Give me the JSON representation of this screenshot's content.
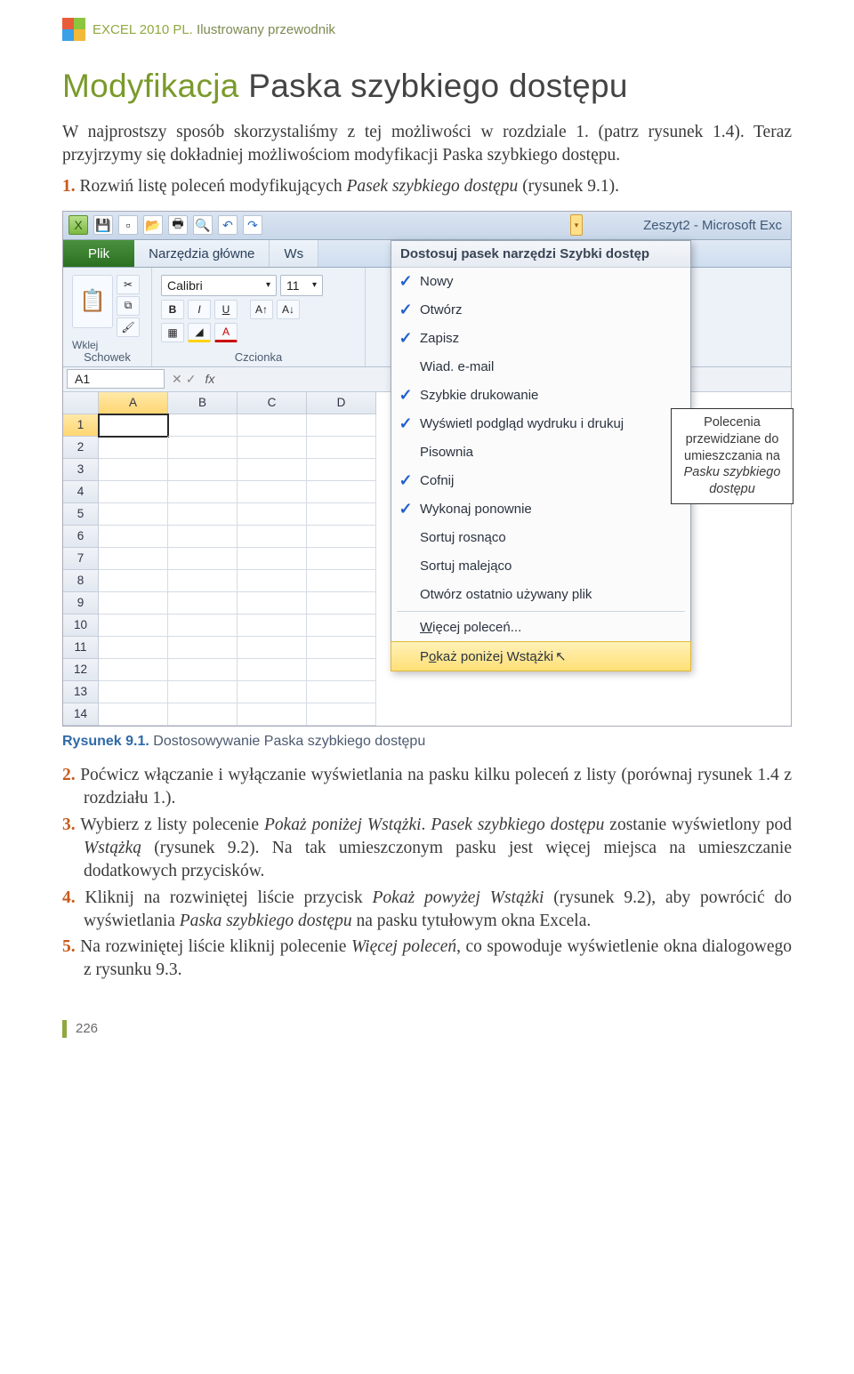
{
  "header": {
    "brand": "EXCEL 2010 PL.",
    "tagline": " Ilustrowany przewodnik"
  },
  "title": {
    "accent": "Modyfikacja",
    "rest": " Paska szybkiego dostępu"
  },
  "intro": "W najprostszy sposób skorzystaliśmy z tej możliwości w rozdziale 1. (patrz rysunek 1.4). Teraz przyjrzymy się dokładniej możliwościom modyfikacji Paska szybkiego dostępu.",
  "step1": {
    "num": "1.",
    "text_a": " Rozwiń listę poleceń modyfikujących ",
    "ital": "Pasek szybkiego dostępu",
    "text_b": " (rysunek 9.1)."
  },
  "excel": {
    "title": "Zeszyt2 - Microsoft Exc",
    "tabs": {
      "file": "Plik",
      "home": "Narzędzia główne",
      "ws": "Ws"
    },
    "ribbon": {
      "clipboard_label": "Schowek",
      "wklej": "Wklej",
      "font_label": "Czcionka",
      "font_name": "Calibri",
      "font_size": "11"
    },
    "name_box": "A1",
    "fx": "fx",
    "columns": [
      "A",
      "B",
      "C",
      "D"
    ],
    "rows": [
      "1",
      "2",
      "3",
      "4",
      "5",
      "6",
      "7",
      "8",
      "9",
      "10",
      "11",
      "12",
      "13",
      "14"
    ]
  },
  "dropdown": {
    "header": "Dostosuj pasek narzędzi Szybki dostęp",
    "items": [
      {
        "label": "Nowy",
        "checked": true
      },
      {
        "label": "Otwórz",
        "checked": true
      },
      {
        "label": "Zapisz",
        "checked": true
      },
      {
        "label": "Wiad. e-mail",
        "checked": false
      },
      {
        "label": "Szybkie drukowanie",
        "checked": true
      },
      {
        "label": "Wyświetl podgląd wydruku i drukuj",
        "checked": true
      },
      {
        "label": "Pisownia",
        "checked": false
      },
      {
        "label": "Cofnij",
        "checked": true
      },
      {
        "label": "Wykonaj ponownie",
        "checked": true
      },
      {
        "label": "Sortuj rosnąco",
        "checked": false
      },
      {
        "label": "Sortuj malejąco",
        "checked": false
      },
      {
        "label": "Otwórz ostatnio używany plik",
        "checked": false
      }
    ],
    "more": "Więcej poleceń...",
    "below": "Pokaż poniżej Wstążki"
  },
  "callout": {
    "l1": "Polecenia przewidziane do umieszczania na ",
    "ital": "Pasku szybkiego dostępu"
  },
  "caption": {
    "rys": "Rysunek 9.1.",
    "text": " Dostosowywanie Paska szybkiego dostępu"
  },
  "steps_after": {
    "s2": {
      "num": "2.",
      "text": " Poćwicz włączanie i wyłączanie wyświetlania na pasku kilku poleceń z listy (porównaj rysunek 1.4 z rozdziału 1.)."
    },
    "s3": {
      "num": "3.",
      "a": " Wybierz z listy polecenie ",
      "i1": "Pokaż poniżej Wstążki",
      "b": ". ",
      "i2": "Pasek szybkiego dostępu",
      "c": " zostanie wyświetlony pod ",
      "i3": "Wstążką",
      "d": " (rysunek 9.2). Na tak umieszczonym pasku jest więcej miejsca na umieszczanie dodatkowych przycisków."
    },
    "s4": {
      "num": "4.",
      "a": " Kliknij na rozwiniętej liście przycisk ",
      "i1": "Pokaż powyżej Wstążki",
      "b": " (rysunek 9.2), aby powrócić do wyświetlania ",
      "i2": "Paska szybkiego dostępu",
      "c": " na pasku tytułowym okna Excela."
    },
    "s5": {
      "num": "5.",
      "a": " Na rozwiniętej liście kliknij polecenie ",
      "i1": "Więcej poleceń",
      "b": ", co spowoduje wyświetlenie okna dialogowego z rysunku 9.3."
    }
  },
  "page_num": "226"
}
